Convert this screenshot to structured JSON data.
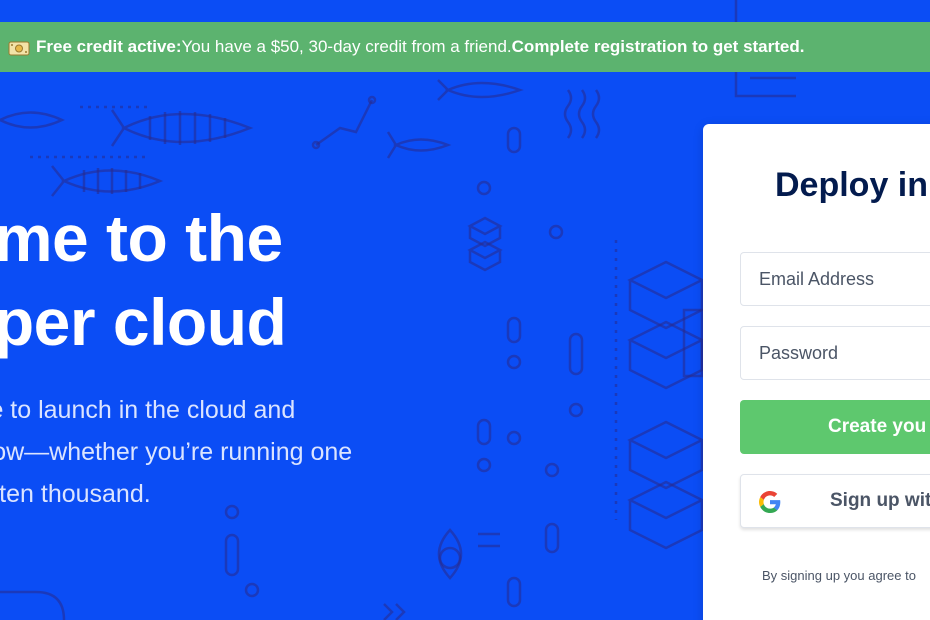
{
  "banner": {
    "icon": "gift-money-icon",
    "lead": "Free credit active:",
    "message": " You have a $50, 30-day credit from a friend. ",
    "cta": "Complete registration to get started."
  },
  "hero": {
    "title_line1": "ome to the",
    "title_line2": "oper cloud",
    "sub_line1": "ble to launch in the cloud and",
    "sub_line2": "grow—whether you’re running one",
    "sub_line3": "or ten thousand."
  },
  "signup": {
    "title": "Deploy in",
    "email_placeholder": "Email Address",
    "password_placeholder": "Password",
    "create_label": "Create you",
    "google_label": "Sign up wit",
    "terms": "By signing up you agree to"
  },
  "colors": {
    "background": "#0b4df5",
    "banner": "#5cb36f",
    "create_button": "#5ec86e",
    "title_text": "#031b4e"
  }
}
